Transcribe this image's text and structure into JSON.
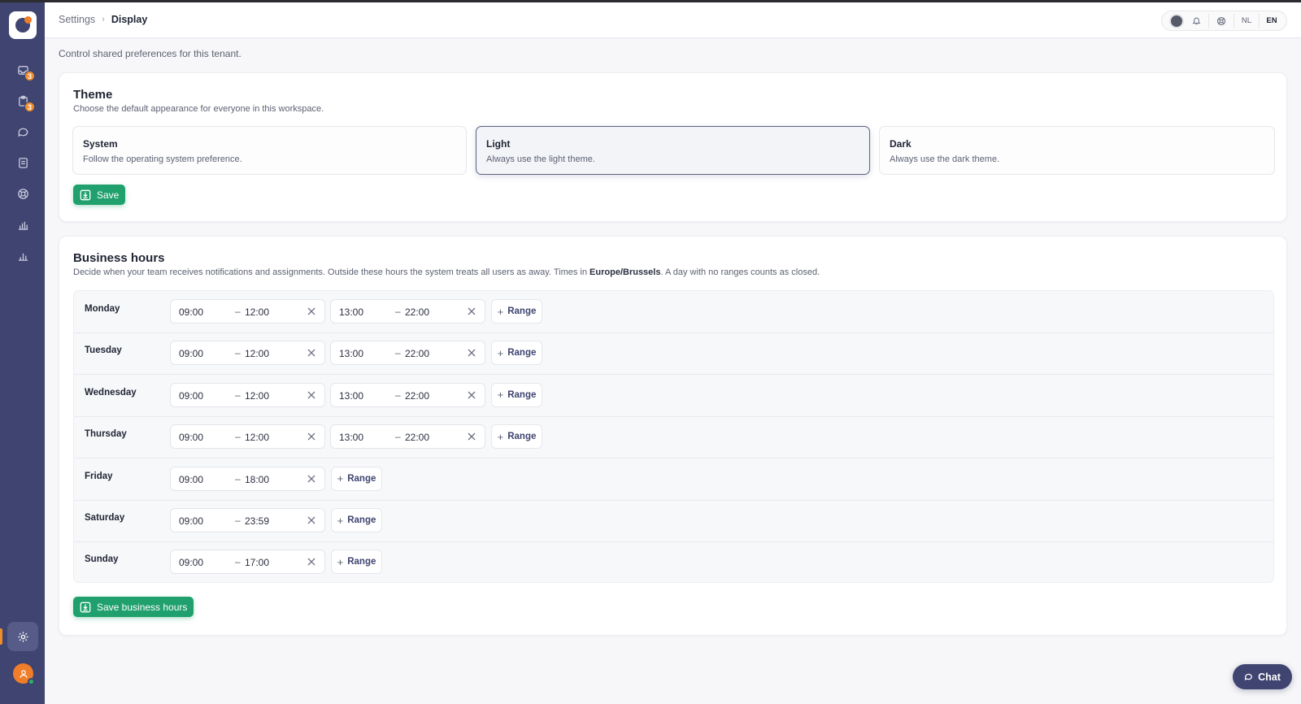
{
  "breadcrumb": {
    "parent": "Settings",
    "current": "Display"
  },
  "header": {
    "lang_nl": "NL",
    "lang_en": "EN",
    "active_lang": "EN"
  },
  "sidebar": {
    "items": [
      {
        "icon": "inbox-icon",
        "badge": "3"
      },
      {
        "icon": "clipboard-icon",
        "badge": "3"
      },
      {
        "icon": "chat-bubble-icon"
      },
      {
        "icon": "document-icon"
      },
      {
        "icon": "lifebuoy-icon"
      },
      {
        "icon": "bar-chart-icon"
      },
      {
        "icon": "bar-chart-alt-icon"
      }
    ],
    "active_item": "settings-gear-icon"
  },
  "page": {
    "description": "Control shared preferences for this tenant."
  },
  "theme": {
    "title": "Theme",
    "subtitle": "Choose the default appearance for everyone in this workspace.",
    "options": [
      {
        "title": "System",
        "description": "Follow the operating system preference.",
        "selected": false
      },
      {
        "title": "Light",
        "description": "Always use the light theme.",
        "selected": true
      },
      {
        "title": "Dark",
        "description": "Always use the dark theme.",
        "selected": false
      }
    ],
    "save_label": "Save"
  },
  "business_hours": {
    "title": "Business hours",
    "subtitle_before": "Decide when your team receives notifications and assignments. Outside these hours the system treats all users as away. Times in ",
    "timezone": "Europe/Brussels",
    "subtitle_after": ". A day with no ranges counts as closed.",
    "add_range_label": "Range",
    "days": [
      {
        "name": "Monday",
        "ranges": [
          {
            "start": "09:00",
            "end": "12:00"
          },
          {
            "start": "13:00",
            "end": "22:00"
          }
        ]
      },
      {
        "name": "Tuesday",
        "ranges": [
          {
            "start": "09:00",
            "end": "12:00"
          },
          {
            "start": "13:00",
            "end": "22:00"
          }
        ]
      },
      {
        "name": "Wednesday",
        "ranges": [
          {
            "start": "09:00",
            "end": "12:00"
          },
          {
            "start": "13:00",
            "end": "22:00"
          }
        ]
      },
      {
        "name": "Thursday",
        "ranges": [
          {
            "start": "09:00",
            "end": "12:00"
          },
          {
            "start": "13:00",
            "end": "22:00"
          }
        ]
      },
      {
        "name": "Friday",
        "ranges": [
          {
            "start": "09:00",
            "end": "18:00"
          }
        ]
      },
      {
        "name": "Saturday",
        "ranges": [
          {
            "start": "09:00",
            "end": "23:59"
          }
        ]
      },
      {
        "name": "Sunday",
        "ranges": [
          {
            "start": "09:00",
            "end": "17:00"
          }
        ]
      }
    ],
    "save_label": "Save business hours"
  },
  "chat": {
    "label": "Chat"
  },
  "colors": {
    "sidebar": "#3f4470",
    "accent_green": "#1fa06c",
    "badge_orange": "#f08d2b"
  }
}
